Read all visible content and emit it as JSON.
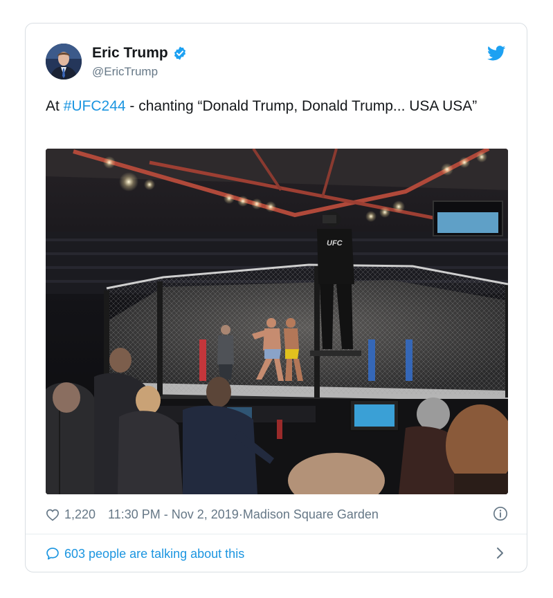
{
  "tweet": {
    "author_name": "Eric Trump",
    "author_handle": "@EricTrump",
    "text_before": "At ",
    "hashtag": "#UFC244",
    "text_after": " - chanting “Donald Trump, Donald Trump... USA USA”",
    "likes": "1,220",
    "timestamp": "11:30 PM - Nov 2, 2019",
    "separator": " · ",
    "location": "Madison Square Garden",
    "conversation": "603 people are talking about this"
  },
  "icons": {
    "verified": "verified-badge-icon",
    "brand": "twitter-bird-icon",
    "like": "heart-icon",
    "info": "info-icon",
    "reply": "speech-bubble-icon",
    "more": "chevron-right-icon"
  },
  "colors": {
    "accent": "#1b95e0",
    "twitter_blue": "#1da1f2",
    "meta_gray": "#657786",
    "text": "#14171a"
  }
}
